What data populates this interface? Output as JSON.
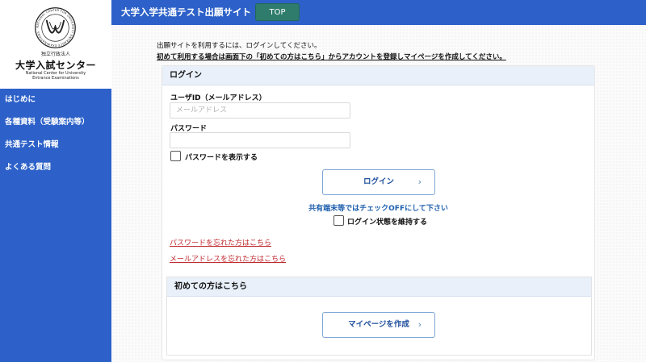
{
  "header": {
    "title": "大学入学共通テスト出願サイト",
    "top_button": "TOP"
  },
  "logo": {
    "seal_text": "NATIONAL CENTER FOR UNIVERSITY ENTRANCE EXAMINATIONS",
    "small": "独立行政法人",
    "main": "大学入試センター",
    "en_line1": "National Center for University",
    "en_line2": "Entrance Examinations"
  },
  "sidebar": {
    "items": [
      {
        "label": "はじめに"
      },
      {
        "label": "各種資料（受験案内等）"
      },
      {
        "label": "共通テスト情報"
      },
      {
        "label": "よくある質問"
      }
    ]
  },
  "intro": {
    "line1": "出願サイトを利用するには、ログインしてください。",
    "line2": "初めて利用する場合は画面下の「初めての方はこちら」からアカウントを登録しマイページを作成してください。"
  },
  "login": {
    "heading": "ログイン",
    "user_id_label": "ユーザID（メールアドレス）",
    "user_id_placeholder": "メールアドレス",
    "user_id_value": "",
    "password_label": "パスワード",
    "password_value": "",
    "show_password_label": "パスワードを表示する",
    "login_button": "ログイン",
    "shared_device_note": "共有端末等ではチェックOFFにして下さい",
    "keep_login_label": "ログイン状態を維持する",
    "forgot_password_link": "パスワードを忘れた方はこちら",
    "forgot_email_link": "メールアドレスを忘れた方はこちら"
  },
  "new_user": {
    "heading": "初めての方はこちら",
    "create_button": "マイページを作成"
  },
  "colors": {
    "primary_blue": "#2d61c9",
    "top_button_green": "#2f7c6d",
    "link_red": "#c0282d",
    "note_blue": "#1f5fae",
    "panel_header": "#e9f0fa"
  },
  "icons": {
    "chevron": "chevron-right-icon",
    "seal": "ncue-seal-logo"
  }
}
